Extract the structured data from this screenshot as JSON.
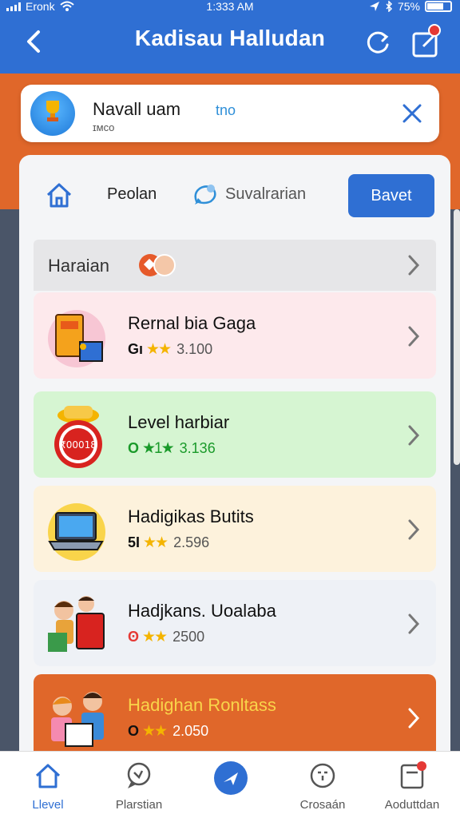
{
  "status_bar": {
    "carrier": "Eronk",
    "time": "1:333 AM",
    "battery": "75%"
  },
  "header": {
    "title": "Kadisau Halludan"
  },
  "user": {
    "name": "Navall uam",
    "tag": "tno",
    "sub": "ɪᴍᴄᴏ"
  },
  "tabs": {
    "home_label": "",
    "peolan": "Peolan",
    "suvalrarian": "Suvalrarian",
    "save": "Bavet"
  },
  "section": {
    "title": "Haraian"
  },
  "cards": [
    {
      "title": "Rernal bia Gaga",
      "prefix": "Gı",
      "stars": "★★",
      "value": "3.100",
      "bg": "#fde9ec",
      "prefix_color": "#111"
    },
    {
      "title": "Level harbiar",
      "prefix": "O",
      "stars": "★1★",
      "value": "3.136",
      "bg": "#d6f5d2",
      "prefix_color": "#1a9a2a"
    },
    {
      "title": "Hadigikas Butits",
      "prefix": "5I",
      "stars": "★★",
      "value": "2.596",
      "bg": "#fdf2dc",
      "prefix_color": "#111"
    },
    {
      "title": "Hadjkans. Uoalaba",
      "prefix": "ʘ",
      "stars": "★★",
      "value": "2500",
      "bg": "#eef1f6",
      "prefix_color": "#e53935"
    },
    {
      "title": "Hadighan Ronltass",
      "prefix": "O",
      "stars": "★★",
      "value": "2.050",
      "bg": "#e0672a",
      "prefix_color": "#111"
    }
  ],
  "bottom_nav": [
    {
      "label": "Llevel",
      "icon": "home-icon",
      "active": true
    },
    {
      "label": "Plarstian",
      "icon": "chat-bubble-icon",
      "active": false
    },
    {
      "label": "",
      "icon": "navigate-icon",
      "active": false
    },
    {
      "label": "Crosaán",
      "icon": "face-icon",
      "active": false
    },
    {
      "label": "Aoduttdan",
      "icon": "notepad-icon",
      "active": false
    }
  ],
  "colors": {
    "primary": "#2f6fd3",
    "accent_orange": "#e0672a",
    "star": "#f4b400"
  }
}
